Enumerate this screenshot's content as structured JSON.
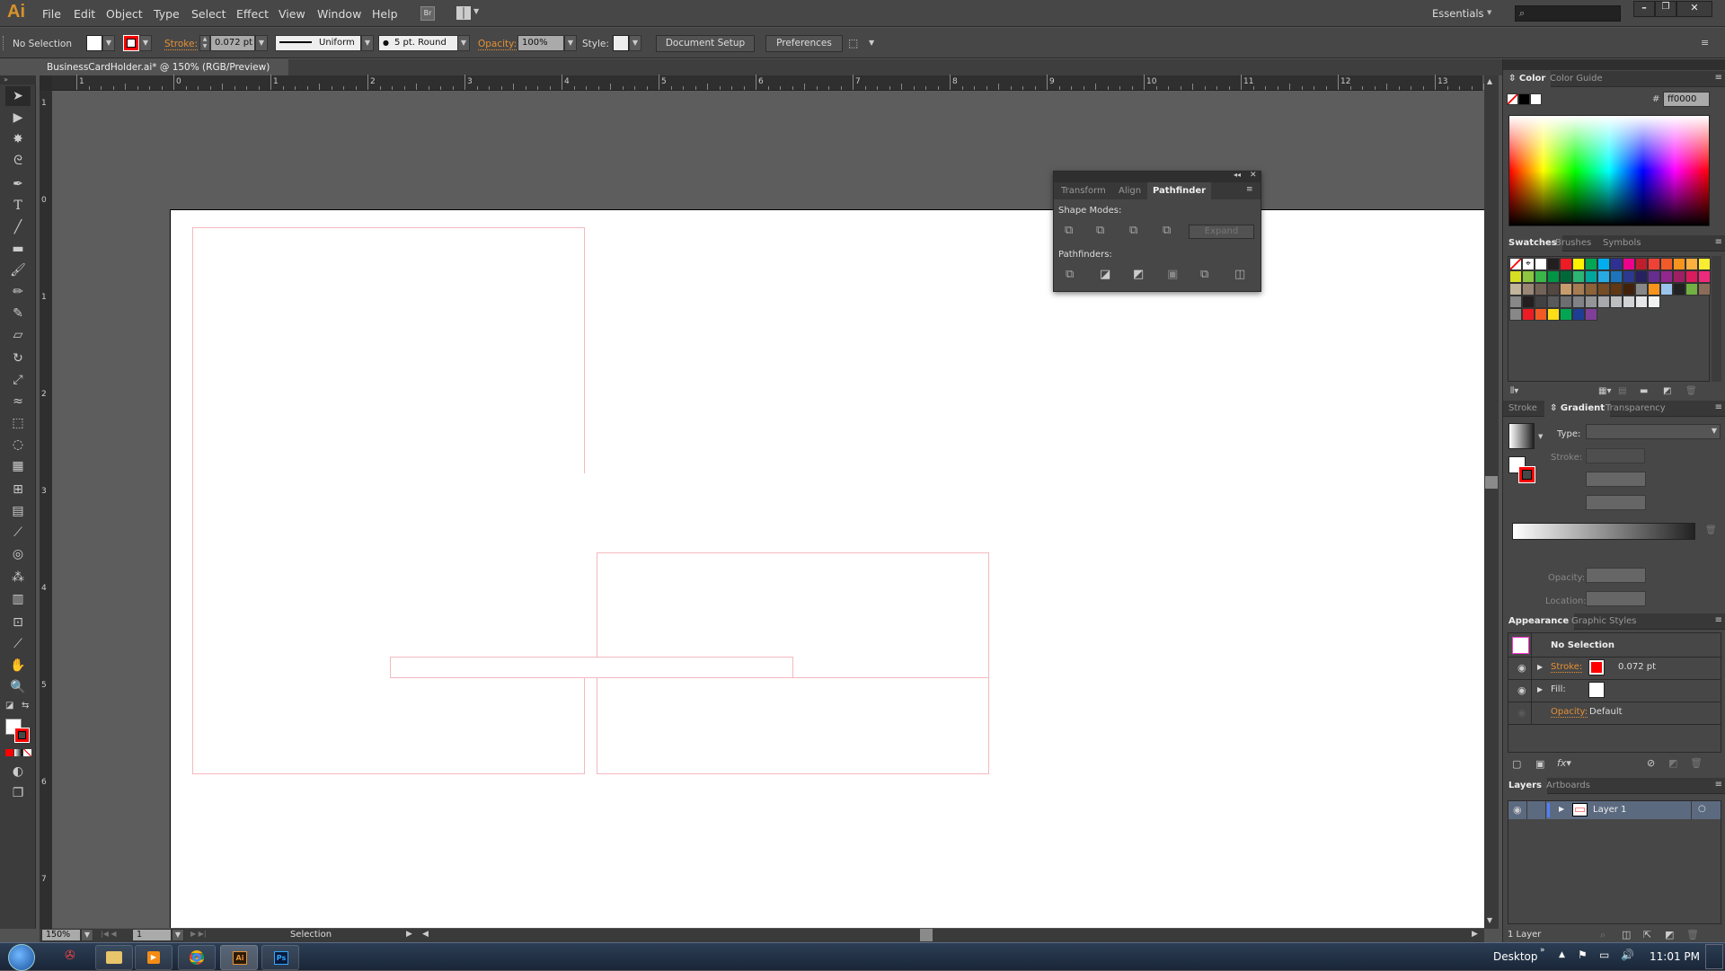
{
  "app": {
    "logo": "Ai",
    "title": "Adobe Illustrator"
  },
  "menu": [
    "File",
    "Edit",
    "Object",
    "Type",
    "Select",
    "Effect",
    "View",
    "Window",
    "Help"
  ],
  "menubar": {
    "bridge_label": "Br",
    "workspace": "Essentials",
    "search_placeholder": ""
  },
  "control": {
    "selection": "No Selection",
    "stroke_label": "Stroke:",
    "stroke_weight": "0.072 pt",
    "profile": "Uniform",
    "brush": "5 pt. Round",
    "opacity_label": "Opacity:",
    "opacity": "100%",
    "style_label": "Style:",
    "doc_setup": "Document Setup",
    "preferences": "Preferences"
  },
  "document": {
    "tab": "BusinessCardHolder.ai* @ 150% (RGB/Preview)",
    "close": "×"
  },
  "ruler_top": [
    "1",
    "0",
    "1",
    "2",
    "3",
    "4",
    "5",
    "6",
    "7",
    "8",
    "9",
    "10",
    "11",
    "12",
    "13"
  ],
  "ruler_left": [
    "1",
    "0",
    "1",
    "2",
    "3",
    "4",
    "5",
    "6",
    "7"
  ],
  "pathfinder": {
    "tabs": [
      "Transform",
      "Align",
      "Pathfinder"
    ],
    "active_tab": "Pathfinder",
    "shape_modes": "Shape Modes:",
    "expand": "Expand",
    "pathfinders": "Pathfinders:"
  },
  "color_panel": {
    "tabs": [
      "Color",
      "Color Guide"
    ],
    "hash": "#",
    "hex": "ff0000"
  },
  "swatches_panel": {
    "tabs": [
      "Swatches",
      "Brushes",
      "Symbols"
    ],
    "row1": [
      "#ffffff",
      "#ffffff",
      "#ffffff",
      "#231f20",
      "#ed1c24",
      "#fff200",
      "#00a651",
      "#00aeef",
      "#2e3192",
      "#ec008c",
      "#be1e2d",
      "#ef4136",
      "#f15a29",
      "#f7941d",
      "#fbb040",
      "#f9ed32"
    ],
    "row2": [
      "#d7df23",
      "#8dc63f",
      "#39b54a",
      "#009444",
      "#006838",
      "#2bb673",
      "#00a79d",
      "#27aae1",
      "#1c75bc",
      "#2b3990",
      "#262262",
      "#662d91",
      "#92278f",
      "#9e1f63",
      "#da1c5c",
      "#ee2a7b"
    ],
    "row3": [
      "#c2b59b",
      "#998675",
      "#736357",
      "#534741",
      "#c69c6d",
      "#a67c52",
      "#8c6239",
      "#754c24",
      "#603813",
      "#42210b",
      "#888888",
      "#f7941d",
      "#9bc4ec",
      "#222222",
      "#72b043",
      "#8b6b5a"
    ],
    "row4": [
      "#231f20",
      "#414042",
      "#58595b",
      "#6d6e71",
      "#808285",
      "#939598",
      "#a7a9ac",
      "#bcbec0",
      "#d1d3d4",
      "#e6e7e8",
      "#f1f2f2"
    ],
    "row5": [
      "#ed1c24",
      "#f15a24",
      "#ffde17",
      "#00a651",
      "#1c3f94",
      "#7f3f98"
    ]
  },
  "gradient_panel": {
    "tabs": [
      "Stroke",
      "Gradient",
      "Transparency"
    ],
    "type_label": "Type:",
    "stroke_label": "Stroke:",
    "opacity_label": "Opacity:",
    "location_label": "Location:"
  },
  "appearance_panel": {
    "tabs": [
      "Appearance",
      "Graphic Styles"
    ],
    "title": "No Selection",
    "stroke_label": "Stroke:",
    "stroke_value": "0.072 pt",
    "fill_label": "Fill:",
    "opacity_label": "Opacity:",
    "opacity_value": "Default",
    "stroke_color": "#ff0000"
  },
  "layers_panel": {
    "tabs": [
      "Layers",
      "Artboards"
    ],
    "layer_name": "Layer 1",
    "count": "1 Layer",
    "layer_color": "#4f7fff"
  },
  "status": {
    "zoom": "150%",
    "artboard": "1",
    "tool": "Selection"
  },
  "taskbar": {
    "desktop": "Desktop",
    "time": "11:01 PM",
    "apps": [
      "Ai",
      "Ps"
    ]
  },
  "colors": {
    "accent_orange": "#e59035",
    "stroke_red": "#ff0000",
    "artwork_stroke": "#f5b8bf"
  }
}
